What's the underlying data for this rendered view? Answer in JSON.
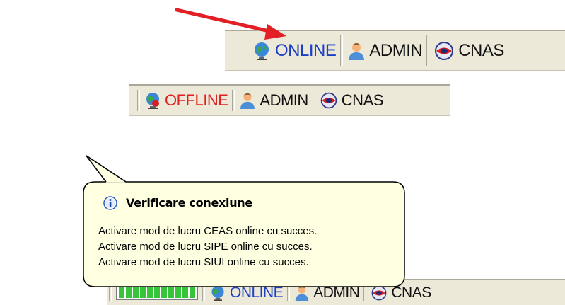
{
  "bar_top": {
    "status_label": "ONLINE",
    "user_label": "ADMIN",
    "org_label": "CNAS"
  },
  "bar_middle": {
    "status_label": "OFFLINE",
    "user_label": "ADMIN",
    "org_label": "CNAS"
  },
  "bar_bottom": {
    "progress_segments": 11,
    "status_label": "ONLINE",
    "user_label": "ADMIN",
    "org_label": "CNAS"
  },
  "balloon": {
    "title": "Verificare conexiune",
    "lines": [
      "Activare mod de lucru CEAS online cu succes.",
      "Activare mod de lucru SIPE online cu succes.",
      "Activare mod de lucru SIUI online cu succes."
    ]
  },
  "colors": {
    "online": "#1c3fc6",
    "offline": "#e02020",
    "toolbar": "#ece9d8",
    "balloon": "#ffffe1",
    "arrow": "#e31e24"
  },
  "icons": [
    "globe-icon",
    "globe-offline-icon",
    "user-icon",
    "cnas-logo-icon",
    "info-icon"
  ]
}
